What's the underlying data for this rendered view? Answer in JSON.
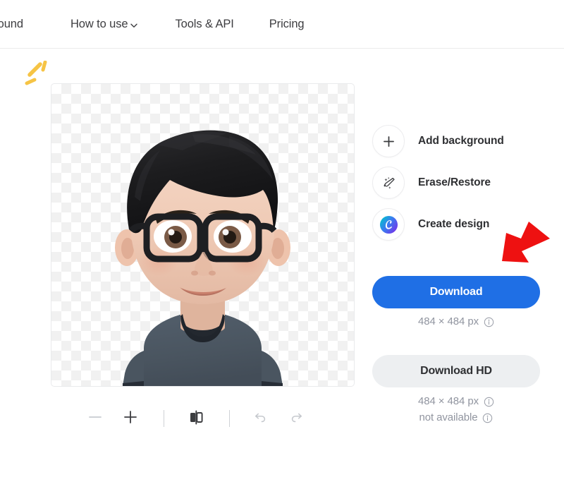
{
  "nav": {
    "items": [
      {
        "label": "kground",
        "icon": null,
        "truncated": true
      },
      {
        "label": "How to use",
        "icon": "chevron-down-icon",
        "truncated": false
      },
      {
        "label": "Tools & API",
        "icon": null,
        "truncated": false
      },
      {
        "label": "Pricing",
        "icon": null,
        "truncated": false
      }
    ]
  },
  "canvas": {
    "background": "transparent-checkerboard",
    "sparkle_icon": "sparkle-icon",
    "sparkle_color": "#f7c64b",
    "subject": "cartoon-avatar-man-with-glasses",
    "subject_colors": {
      "hair": "#1d1d1f",
      "skin": "#f0cdb9",
      "glasses": "#222327",
      "shirt": "#4c5764",
      "shirt_trim": "#2b313a"
    }
  },
  "toolbar": {
    "zoom_out_label": "−",
    "zoom_out_name": "zoom-out-icon",
    "zoom_in_label": "+",
    "zoom_in_name": "zoom-in-icon",
    "compare_name": "compare-split-icon",
    "undo_name": "undo-icon",
    "redo_name": "redo-icon"
  },
  "actions": [
    {
      "label": "Add background",
      "icon": "plus-icon"
    },
    {
      "label": "Erase/Restore",
      "icon": "magic-brush-icon"
    },
    {
      "label": "Create design",
      "icon": "canva-logo-icon"
    }
  ],
  "download": {
    "primary_label": "Download",
    "primary_size": "484 × 484 px",
    "secondary_label": "Download HD",
    "secondary_size": "484 × 484 px",
    "secondary_status": "not available",
    "info_icon": "info-circle-icon",
    "primary_color": "#1f6fe5",
    "secondary_color": "#edeff1"
  },
  "annotation": {
    "arrow_icon": "red-arrow-icon",
    "arrow_color": "#ee1111",
    "points_to": "Download"
  }
}
